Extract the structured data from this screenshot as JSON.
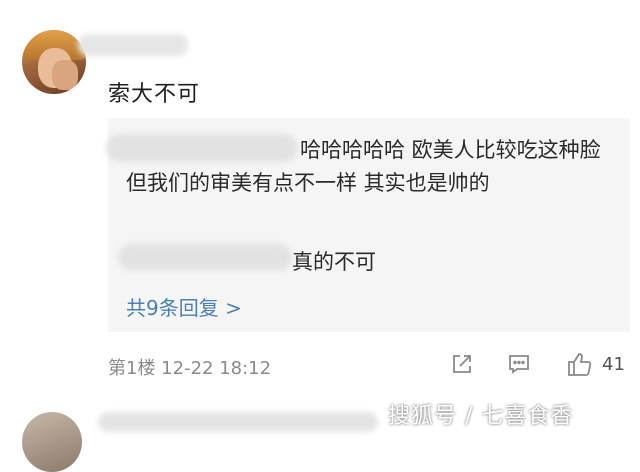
{
  "comment": {
    "text": "索大不可"
  },
  "replies": [
    {
      "text": "哈哈哈哈哈 欧美人比较吃这种脸 但我们的审美有点不一样 其实也是帅的"
    },
    {
      "text": "真的不可"
    }
  ],
  "more_replies_label": "共9条回复 >",
  "meta": {
    "floor_time": "第1楼  12-22 18:12"
  },
  "actions": {
    "like_count": "41"
  },
  "watermark": "搜狐号 / 七喜食香",
  "icons": [
    "share-icon",
    "comment-icon",
    "thumbs-up-icon"
  ],
  "colors": {
    "link": "#4a7fb8",
    "reply_bg": "#f5f5f5",
    "meta": "#8a8a8a"
  }
}
